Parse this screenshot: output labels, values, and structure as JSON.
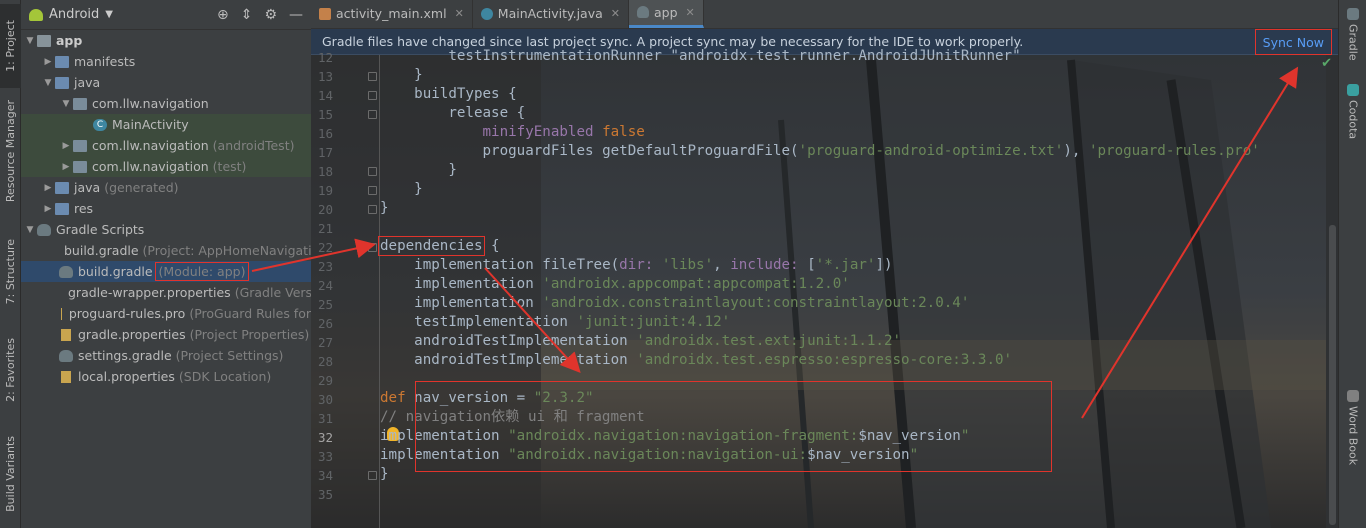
{
  "left_strip": {
    "tabs": [
      {
        "label": "1: Project"
      },
      {
        "label": "Resource Manager"
      },
      {
        "label": "7: Structure"
      },
      {
        "label": "2: Favorites"
      },
      {
        "label": "Build Variants"
      }
    ]
  },
  "project": {
    "view": "Android",
    "tree": [
      {
        "name": "app",
        "hint": ""
      },
      {
        "name": "manifests",
        "hint": ""
      },
      {
        "name": "java",
        "hint": ""
      },
      {
        "name": "com.llw.navigation",
        "hint": ""
      },
      {
        "name": "MainActivity",
        "hint": ""
      },
      {
        "name": "com.llw.navigation",
        "hint": "(androidTest)"
      },
      {
        "name": "com.llw.navigation",
        "hint": "(test)"
      },
      {
        "name": "java",
        "hint": "(generated)"
      },
      {
        "name": "res",
        "hint": ""
      },
      {
        "name": "Gradle Scripts",
        "hint": ""
      },
      {
        "name": "build.gradle",
        "hint": "(Project: AppHomeNavigati"
      },
      {
        "name": "build.gradle",
        "hint": "(Module: app)"
      },
      {
        "name": "gradle-wrapper.properties",
        "hint": "(Gradle Vers"
      },
      {
        "name": "proguard-rules.pro",
        "hint": "(ProGuard Rules for"
      },
      {
        "name": "gradle.properties",
        "hint": "(Project Properties)"
      },
      {
        "name": "settings.gradle",
        "hint": "(Project Settings)"
      },
      {
        "name": "local.properties",
        "hint": "(SDK Location)"
      }
    ]
  },
  "editor": {
    "tabs": [
      {
        "label": "activity_main.xml"
      },
      {
        "label": "MainActivity.java"
      },
      {
        "label": "app"
      }
    ],
    "banner": {
      "message": "Gradle files have changed since last project sync. A project sync may be necessary for the IDE to work properly.",
      "sync_label": "Sync Now"
    },
    "line_numbers": [
      "12",
      "13",
      "14",
      "15",
      "16",
      "17",
      "18",
      "19",
      "20",
      "21",
      "22",
      "23",
      "24",
      "25",
      "26",
      "27",
      "28",
      "29",
      "30",
      "31",
      "32",
      "33",
      "34",
      "35"
    ],
    "code": {
      "l12": "        testInstrumentationRunner \"androidx.test.runner.AndroidJUnitRunner\"",
      "l13": "    }",
      "l14": "    buildTypes {",
      "l15": "        release {",
      "l16a": "            ",
      "l16b": "minifyEnabled",
      "l16c": " false",
      "l17a": "            proguardFiles getDefaultProguardFile(",
      "l17b": "'proguard-android-optimize.txt'",
      "l17c": "), ",
      "l17d": "'proguard-rules.pro'",
      "l18": "        }",
      "l19": "    }",
      "l20": "}",
      "l22a": "dependencies",
      "l22b": " {",
      "l23a": "    implementation fileTree(",
      "l23b": "dir: ",
      "l23c": "'libs'",
      "l23d": ", ",
      "l23e": "include: ",
      "l23f": "[",
      "l23g": "'*.jar'",
      "l23h": "])",
      "l24a": "    implementation ",
      "l24b": "'androidx.appcompat:appcompat:1.2.0'",
      "l25a": "    implementation ",
      "l25b": "'androidx.constraintlayout:constraintlayout:2.0.4'",
      "l26a": "    testImplementation ",
      "l26b": "'junit:junit:4.12'",
      "l27a": "    androidTestImplementation ",
      "l27b": "'androidx.test.ext:junit:1.1.2'",
      "l28a": "    androidTestImplementation ",
      "l28b": "'androidx.test.espresso:espresso-core:3.3.0'",
      "l30a": "def",
      "l30b": " nav_version = ",
      "l30c": "\"2.3.2\"",
      "l31": "// navigation依赖 ui 和 fragment",
      "l32a": "implementation ",
      "l32b": "\"androidx.navigation:navigation-fragment:",
      "l32c": "$nav_version",
      "l32d": "\"",
      "l33a": "implementation ",
      "l33b": "\"androidx.navigation:navigation-ui:",
      "l33c": "$nav_version",
      "l33d": "\"",
      "l34": "}"
    }
  },
  "right_strip": {
    "tabs": [
      {
        "label": "Gradle"
      },
      {
        "label": "Codota"
      },
      {
        "label": "Word Book"
      }
    ]
  },
  "colors": {
    "keyword": "#cc7832",
    "string": "#6a8759",
    "property": "#9876aa",
    "comment": "#808080",
    "annotation_red": "#e0342c",
    "link": "#589df6"
  }
}
